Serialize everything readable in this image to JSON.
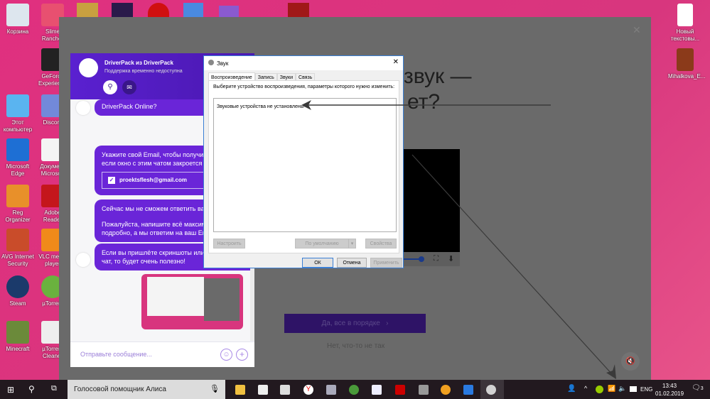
{
  "desktop": {
    "icons": [
      "Корзина",
      "Slime Rancher",
      "GeForce Experience",
      "Этот компьютер",
      "Discord",
      "Microsoft Edge",
      "Документ Microsoft",
      "Reg Organizer",
      "Adobe Reader",
      "AVG Internet Security",
      "VLC media player",
      "Steam",
      "µTorrent",
      "Minecraft",
      "µTorrent Cleaner",
      "Новый текстовы...",
      "Mihalkova_E..."
    ]
  },
  "page": {
    "heading_line1": "звук —",
    "heading_line2": "ет?",
    "ok_button": "Да, все в порядке",
    "ok_arrow": "›",
    "not_ok_link": "Нет, что-то не так"
  },
  "chat": {
    "title": "DriverPack из DriverPack",
    "subtitle": "Поддержка временно недоступна",
    "messages": [
      "DriverPack Online?",
      "Укажите свой Email, чтобы получить ответ даже если окно с этим чатом закроется",
      "Сейчас мы не сможем ответить вам",
      "Пожалуйста, напишите всё максимально подробно, а мы ответим на ваш Email",
      "Если вы пришлёте скриншоты или ссылки в этот чат, то будет очень полезно!"
    ],
    "email": "proektsflesh@gmail.com",
    "input_placeholder": "Отправьте сообщение..."
  },
  "dialog": {
    "title": "Звук",
    "tabs": [
      "Воспроизведение",
      "Запись",
      "Звуки",
      "Связь"
    ],
    "instruction": "Выберите устройство воспроизведения, параметры которого нужно изменить:",
    "empty_text": "Звуковые устройства не установлены",
    "configure": "Настроить",
    "default": "По умолчанию",
    "properties": "Свойства",
    "ok": "ОК",
    "cancel": "Отмена",
    "apply": "Применить"
  },
  "taskbar": {
    "search_text": "Голосовой помощник Алиса",
    "lang": "ENG",
    "time": "13:43",
    "date": "01.02.2019",
    "notif_count": "3"
  }
}
